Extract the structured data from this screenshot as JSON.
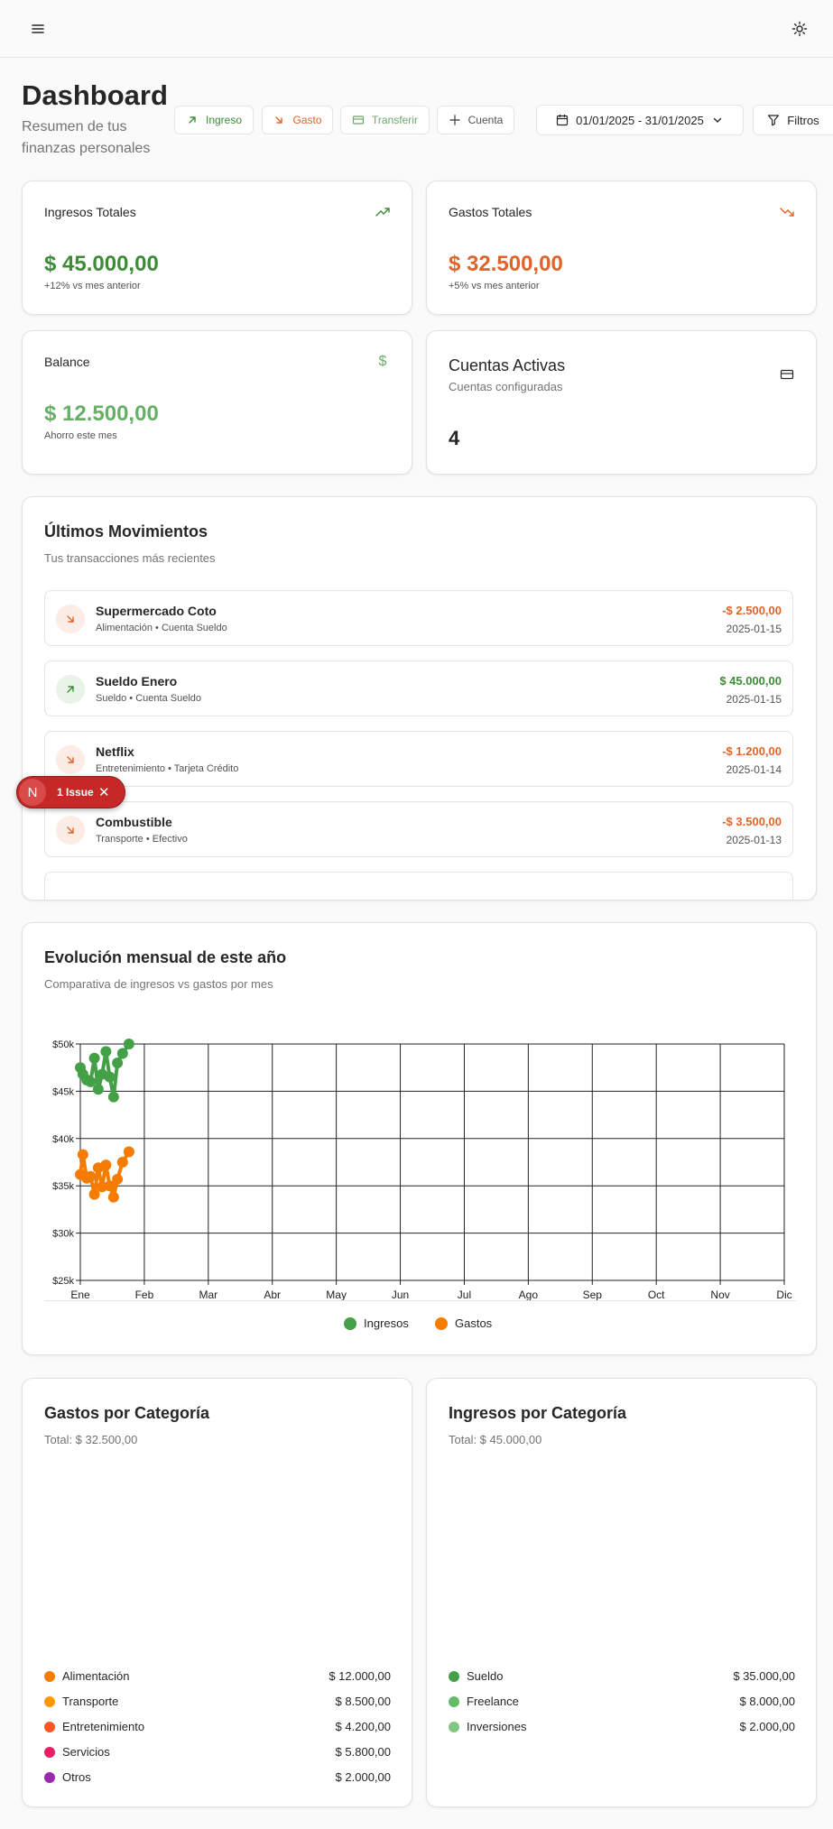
{
  "page": {
    "title": "Dashboard",
    "subtitle": "Resumen de tus finanzas personales"
  },
  "icons": {
    "menu": "menu-icon",
    "theme": "sun-icon"
  },
  "actions": {
    "ingreso": {
      "label": "Ingreso",
      "color": "#3d8b37"
    },
    "gasto": {
      "label": "Gasto",
      "color": "#e0642a"
    },
    "transferir": {
      "label": "Transferir",
      "color": "#6aa86a"
    },
    "cuenta": {
      "label": "Cuenta",
      "color": "#525252"
    },
    "date_range": "01/01/2025 - 31/01/2025",
    "filtros": "Filtros"
  },
  "stats": {
    "ingresos": {
      "title": "Ingresos Totales",
      "value": "$ 45.000,00",
      "note": "+12% vs mes anterior",
      "color": "#3d8b37"
    },
    "gastos": {
      "title": "Gastos Totales",
      "value": "$ 32.500,00",
      "note": "+5% vs mes anterior",
      "color": "#e0642a"
    },
    "balance": {
      "title": "Balance",
      "value": "$ 12.500,00",
      "note": "Ahorro este mes",
      "color": "#66b066"
    },
    "cuentas": {
      "title": "Cuentas Activas",
      "subtitle": "Cuentas configuradas",
      "value": "4"
    }
  },
  "movimientos": {
    "title": "Últimos Movimientos",
    "subtitle": "Tus transacciones más recientes",
    "items": [
      {
        "name": "Supermercado Coto",
        "meta": "Alimentación • Cuenta Sueldo",
        "amount": "-$ 2.500,00",
        "date": "2025-01-15",
        "type": "gasto"
      },
      {
        "name": "Sueldo Enero",
        "meta": "Sueldo • Cuenta Sueldo",
        "amount": "$ 45.000,00",
        "date": "2025-01-15",
        "type": "ingreso"
      },
      {
        "name": "Netflix",
        "meta": "Entretenimiento • Tarjeta Crédito",
        "amount": "-$ 1.200,00",
        "date": "2025-01-14",
        "type": "gasto"
      },
      {
        "name": "Combustible",
        "meta": "Transporte • Efectivo",
        "amount": "-$ 3.500,00",
        "date": "2025-01-13",
        "type": "gasto"
      }
    ]
  },
  "issue_badge": {
    "logo": "N",
    "text": "1 Issue"
  },
  "evolucion": {
    "title": "Evolución mensual de este año",
    "subtitle": "Comparativa de ingresos vs gastos por mes"
  },
  "chart_data": {
    "type": "line",
    "categories": [
      "Ene",
      "Feb",
      "Mar",
      "Abr",
      "May",
      "Jun",
      "Jul",
      "Ago",
      "Sep",
      "Oct",
      "Nov",
      "Dic"
    ],
    "y_ticks": [
      "$25k",
      "$30k",
      "$35k",
      "$40k",
      "$45k",
      "$50k"
    ],
    "ylim": [
      25000,
      50000
    ],
    "grid": true,
    "legend_position": "bottom",
    "series": [
      {
        "name": "Ingresos",
        "color": "#43a047",
        "x": [
          0.0,
          0.04,
          0.1,
          0.16,
          0.22,
          0.28,
          0.34,
          0.4,
          0.46,
          0.52,
          0.58,
          0.66,
          0.76
        ],
        "values": [
          47500,
          46800,
          46200,
          46000,
          48500,
          45200,
          46800,
          49200,
          46500,
          44400,
          48000,
          49000,
          50000
        ]
      },
      {
        "name": "Gastos",
        "color": "#f57c00",
        "x": [
          0.0,
          0.04,
          0.1,
          0.16,
          0.22,
          0.28,
          0.34,
          0.4,
          0.46,
          0.52,
          0.58,
          0.66,
          0.76
        ],
        "values": [
          36200,
          38300,
          35800,
          36000,
          34100,
          36900,
          34900,
          37200,
          35000,
          33800,
          35700,
          37500,
          38600
        ]
      }
    ]
  },
  "gastos_cat": {
    "title": "Gastos por Categoría",
    "total": "Total: $ 32.500,00",
    "items": [
      {
        "name": "Alimentación",
        "value": "$ 12.000,00",
        "color": "#f57c00"
      },
      {
        "name": "Transporte",
        "value": "$ 8.500,00",
        "color": "#ff9800"
      },
      {
        "name": "Entretenimiento",
        "value": "$ 4.200,00",
        "color": "#ff5722"
      },
      {
        "name": "Servicios",
        "value": "$ 5.800,00",
        "color": "#e91e63"
      },
      {
        "name": "Otros",
        "value": "$ 2.000,00",
        "color": "#9c27b0"
      }
    ]
  },
  "ingresos_cat": {
    "title": "Ingresos por Categoría",
    "total": "Total: $ 45.000,00",
    "items": [
      {
        "name": "Sueldo",
        "value": "$ 35.000,00",
        "color": "#43a047"
      },
      {
        "name": "Freelance",
        "value": "$ 8.000,00",
        "color": "#66bb6a"
      },
      {
        "name": "Inversiones",
        "value": "$ 2.000,00",
        "color": "#81c784"
      }
    ]
  }
}
